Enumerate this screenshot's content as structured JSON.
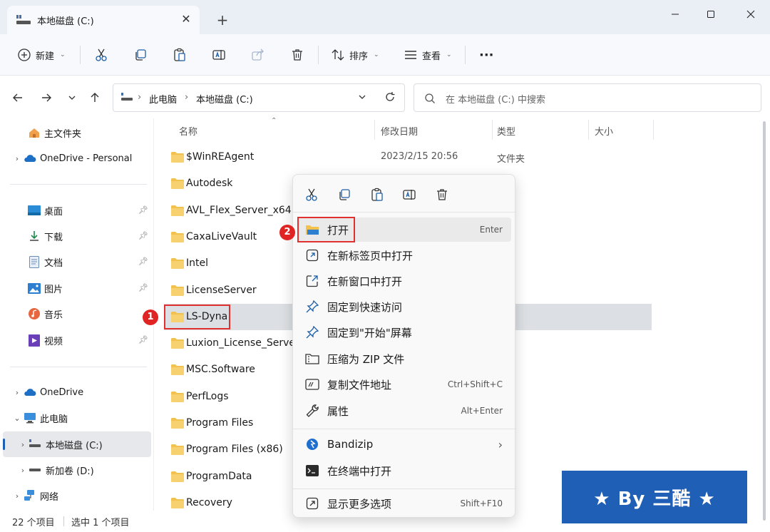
{
  "window": {
    "tab_title": "本地磁盘 (C:)",
    "new_tab": "+",
    "close_tab": "✕"
  },
  "toolbar": {
    "new_label": "新建",
    "sort_label": "排序",
    "view_label": "查看",
    "more": "···"
  },
  "address": {
    "crumbs": [
      "此电脑",
      "本地磁盘 (C:)"
    ],
    "search_placeholder": "在 本地磁盘 (C:) 中搜索"
  },
  "sidebar": {
    "home": "主文件夹",
    "onedrive_personal": "OneDrive - Personal",
    "quick": [
      {
        "label": "桌面"
      },
      {
        "label": "下载"
      },
      {
        "label": "文档"
      },
      {
        "label": "图片"
      },
      {
        "label": "音乐"
      },
      {
        "label": "视频"
      }
    ],
    "onedrive": "OneDrive",
    "this_pc": "此电脑",
    "drive_c": "本地磁盘 (C:)",
    "drive_d": "新加卷 (D:)",
    "network": "网络"
  },
  "columns": {
    "name": "名称",
    "modified": "修改日期",
    "type": "类型",
    "size": "大小"
  },
  "files": [
    {
      "name": "$WinREAgent",
      "date": "2023/2/15 20:56",
      "type": "文件夹"
    },
    {
      "name": "Autodesk",
      "date": "",
      "type": "夹"
    },
    {
      "name": "AVL_Flex_Server_x64",
      "date": "",
      "type": "夹"
    },
    {
      "name": "CaxaLiveVault",
      "date": "",
      "type": "夹"
    },
    {
      "name": "Intel",
      "date": "",
      "type": "夹"
    },
    {
      "name": "LicenseServer",
      "date": "",
      "type": "夹"
    },
    {
      "name": "LS-Dyna",
      "date": "",
      "type": "夹"
    },
    {
      "name": "Luxion_License_Server",
      "date": "",
      "type": "夹"
    },
    {
      "name": "MSC.Software",
      "date": "",
      "type": "夹"
    },
    {
      "name": "PerfLogs",
      "date": "",
      "type": "夹"
    },
    {
      "name": "Program Files",
      "date": "",
      "type": "夹"
    },
    {
      "name": "Program Files (x86)",
      "date": "",
      "type": "夹"
    },
    {
      "name": "ProgramData",
      "date": "",
      "type": "夹"
    },
    {
      "name": "Recovery",
      "date": "",
      "type": "夹"
    }
  ],
  "status": {
    "count": "22 个项目",
    "selected": "选中 1 个项目"
  },
  "context_menu": {
    "items": [
      {
        "label": "打开",
        "key": "Enter"
      },
      {
        "label": "在新标签页中打开",
        "key": ""
      },
      {
        "label": "在新窗口中打开",
        "key": ""
      },
      {
        "label": "固定到快速访问",
        "key": ""
      },
      {
        "label": "固定到\"开始\"屏幕",
        "key": ""
      },
      {
        "label": "压缩为 ZIP 文件",
        "key": ""
      },
      {
        "label": "复制文件地址",
        "key": "Ctrl+Shift+C"
      },
      {
        "label": "属性",
        "key": "Alt+Enter"
      },
      {
        "label": "Bandizip",
        "key": "›"
      },
      {
        "label": "在终端中打开",
        "key": ""
      },
      {
        "label": "显示更多选项",
        "key": "Shift+F10"
      }
    ]
  },
  "annotations": {
    "badge1": "1",
    "badge2": "2",
    "banner": "★ By 三酷 ★"
  },
  "colors": {
    "folder": "#f2c14e",
    "accent": "#1f5fb5",
    "highlight": "#e03030"
  }
}
